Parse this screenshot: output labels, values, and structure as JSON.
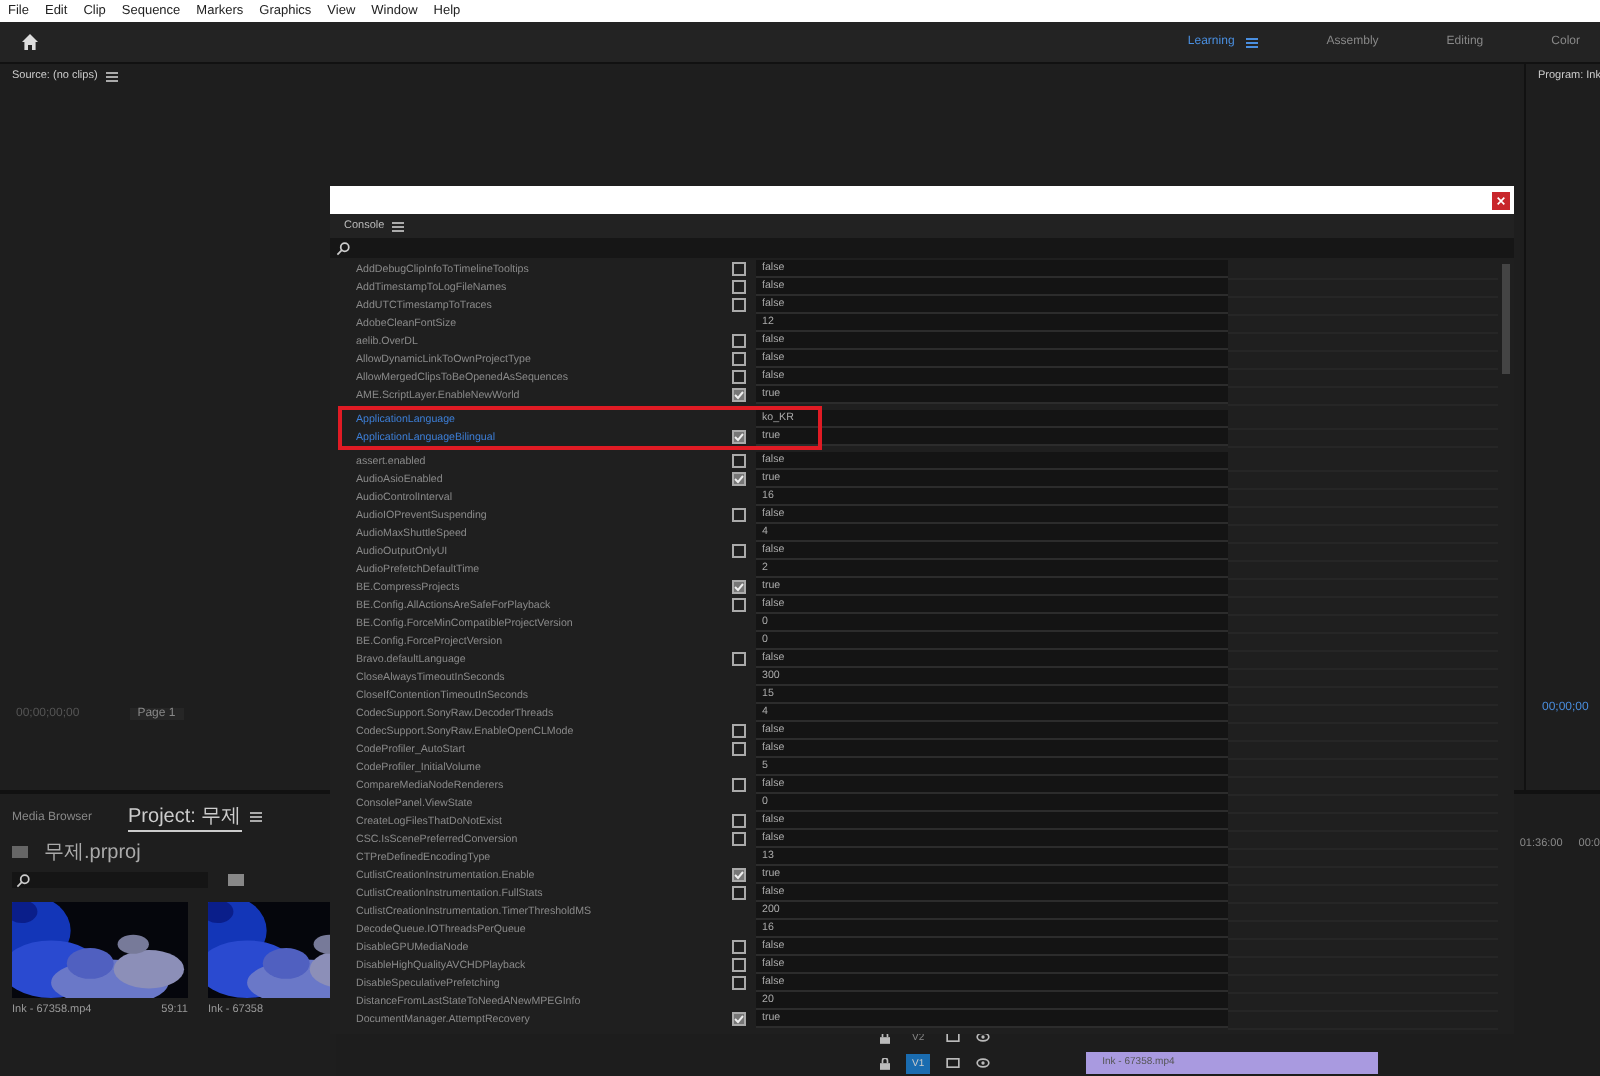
{
  "menu": [
    "File",
    "Edit",
    "Clip",
    "Sequence",
    "Markers",
    "Graphics",
    "View",
    "Window",
    "Help"
  ],
  "workspaces": [
    {
      "label": "Learning",
      "selected": true
    },
    {
      "label": "Assembly",
      "selected": false
    },
    {
      "label": "Editing",
      "selected": false
    },
    {
      "label": "Color",
      "selected": false
    }
  ],
  "source_panel": {
    "title": "Source: (no clips)",
    "timecode": "00;00;00;00",
    "page": "Page 1"
  },
  "program_panel": {
    "title": "Program: Ink",
    "timecode": "00;00;00"
  },
  "project_panel": {
    "tabs": [
      {
        "label": "Media Browser",
        "selected": false
      },
      {
        "label": "Project: 무제",
        "selected": true
      }
    ],
    "file": "무제.prproj",
    "items": [
      {
        "name": "Ink - 67358.mp4",
        "duration": "59:11"
      },
      {
        "name": "Ink - 67358"
      }
    ]
  },
  "timeline": {
    "ruler": [
      "01:36:00",
      "00:0"
    ],
    "tracks": [
      {
        "label": "V2",
        "selected": false
      },
      {
        "label": "V1",
        "selected": true
      }
    ],
    "clip": "Ink - 67358.mp4"
  },
  "console": {
    "tab": "Console",
    "rows": [
      {
        "name": "AddDebugClipInfoToTimelineTooltips",
        "kind": "bool",
        "checked": false,
        "value": "false",
        "selected": false
      },
      {
        "name": "AddTimestampToLogFileNames",
        "kind": "bool",
        "checked": false,
        "value": "false",
        "selected": false
      },
      {
        "name": "AddUTCTimestampToTraces",
        "kind": "bool",
        "checked": false,
        "value": "false",
        "selected": false
      },
      {
        "name": "AdobeCleanFontSize",
        "kind": "text",
        "value": "12",
        "selected": false
      },
      {
        "name": "aelib.OverDL",
        "kind": "bool",
        "checked": false,
        "value": "false",
        "selected": false
      },
      {
        "name": "AllowDynamicLinkToOwnProjectType",
        "kind": "bool",
        "checked": false,
        "value": "false",
        "selected": false
      },
      {
        "name": "AllowMergedClipsToBeOpenedAsSequences",
        "kind": "bool",
        "checked": false,
        "value": "false",
        "selected": false
      },
      {
        "name": "AME.ScriptLayer.EnableNewWorld",
        "kind": "bool",
        "checked": true,
        "value": "true",
        "selected": false
      },
      {
        "name": "ApplicationLanguage",
        "kind": "text",
        "value": "ko_KR",
        "selected": true
      },
      {
        "name": "ApplicationLanguageBilingual",
        "kind": "bool",
        "checked": true,
        "value": "true",
        "selected": true
      },
      {
        "name": "assert.enabled",
        "kind": "bool",
        "checked": false,
        "value": "false",
        "selected": false
      },
      {
        "name": "AudioAsioEnabled",
        "kind": "bool",
        "checked": true,
        "value": "true",
        "selected": false
      },
      {
        "name": "AudioControlInterval",
        "kind": "text",
        "value": "16",
        "selected": false
      },
      {
        "name": "AudioIOPreventSuspending",
        "kind": "bool",
        "checked": false,
        "value": "false",
        "selected": false
      },
      {
        "name": "AudioMaxShuttleSpeed",
        "kind": "text",
        "value": "4",
        "selected": false
      },
      {
        "name": "AudioOutputOnlyUI",
        "kind": "bool",
        "checked": false,
        "value": "false",
        "selected": false
      },
      {
        "name": "AudioPrefetchDefaultTime",
        "kind": "text",
        "value": "2",
        "selected": false
      },
      {
        "name": "BE.CompressProjects",
        "kind": "bool",
        "checked": true,
        "value": "true",
        "selected": false
      },
      {
        "name": "BE.Config.AllActionsAreSafeForPlayback",
        "kind": "bool",
        "checked": false,
        "value": "false",
        "selected": false
      },
      {
        "name": "BE.Config.ForceMinCompatibleProjectVersion",
        "kind": "text",
        "value": "0",
        "selected": false
      },
      {
        "name": "BE.Config.ForceProjectVersion",
        "kind": "text",
        "value": "0",
        "selected": false
      },
      {
        "name": "Bravo.defaultLanguage",
        "kind": "bool",
        "checked": false,
        "value": "false",
        "selected": false
      },
      {
        "name": "CloseAlwaysTimeoutInSeconds",
        "kind": "text",
        "value": "300",
        "selected": false
      },
      {
        "name": "CloseIfContentionTimeoutInSeconds",
        "kind": "text",
        "value": "15",
        "selected": false
      },
      {
        "name": "CodecSupport.SonyRaw.DecoderThreads",
        "kind": "text",
        "value": "4",
        "selected": false
      },
      {
        "name": "CodecSupport.SonyRaw.EnableOpenCLMode",
        "kind": "bool",
        "checked": false,
        "value": "false",
        "selected": false
      },
      {
        "name": "CodeProfiler_AutoStart",
        "kind": "bool",
        "checked": false,
        "value": "false",
        "selected": false
      },
      {
        "name": "CodeProfiler_InitialVolume",
        "kind": "text",
        "value": "5",
        "selected": false
      },
      {
        "name": "CompareMediaNodeRenderers",
        "kind": "bool",
        "checked": false,
        "value": "false",
        "selected": false
      },
      {
        "name": "ConsolePanel.ViewState",
        "kind": "text",
        "value": "0",
        "selected": false
      },
      {
        "name": "CreateLogFilesThatDoNotExist",
        "kind": "bool",
        "checked": false,
        "value": "false",
        "selected": false
      },
      {
        "name": "CSC.IsScenePreferredConversion",
        "kind": "bool",
        "checked": false,
        "value": "false",
        "selected": false
      },
      {
        "name": "CTPreDefinedEncodingType",
        "kind": "text",
        "value": "13",
        "selected": false
      },
      {
        "name": "CutlistCreationInstrumentation.Enable",
        "kind": "bool",
        "checked": true,
        "value": "true",
        "selected": false
      },
      {
        "name": "CutlistCreationInstrumentation.FullStats",
        "kind": "bool",
        "checked": false,
        "value": "false",
        "selected": false
      },
      {
        "name": "CutlistCreationInstrumentation.TimerThresholdMS",
        "kind": "text",
        "value": "200",
        "selected": false
      },
      {
        "name": "DecodeQueue.IOThreadsPerQueue",
        "kind": "text",
        "value": "16",
        "selected": false
      },
      {
        "name": "DisableGPUMediaNode",
        "kind": "bool",
        "checked": false,
        "value": "false",
        "selected": false
      },
      {
        "name": "DisableHighQualityAVCHDPlayback",
        "kind": "bool",
        "checked": false,
        "value": "false",
        "selected": false
      },
      {
        "name": "DisableSpeculativePrefetching",
        "kind": "bool",
        "checked": false,
        "value": "false",
        "selected": false
      },
      {
        "name": "DistanceFromLastStateToNeedANewMPEGInfo",
        "kind": "text",
        "value": "20",
        "selected": false
      },
      {
        "name": "DocumentManager.AttemptRecovery",
        "kind": "bool",
        "checked": true,
        "value": "true",
        "selected": false
      }
    ]
  }
}
